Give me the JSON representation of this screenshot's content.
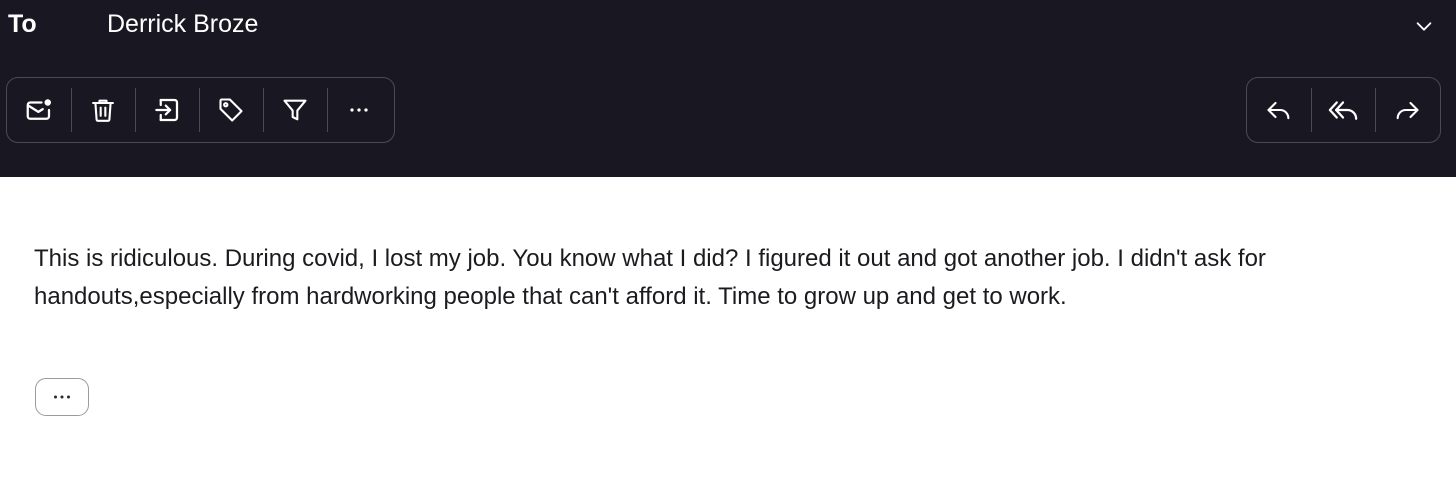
{
  "header": {
    "to_label": "To",
    "recipient": "Derrick Broze",
    "expand_icon": "chevron-down-icon"
  },
  "toolbar_left": [
    {
      "icon": "mark-unread-icon"
    },
    {
      "icon": "trash-icon"
    },
    {
      "icon": "move-to-folder-icon"
    },
    {
      "icon": "tag-icon"
    },
    {
      "icon": "filter-icon"
    },
    {
      "icon": "more-horizontal-icon"
    }
  ],
  "toolbar_right": [
    {
      "icon": "reply-icon"
    },
    {
      "icon": "reply-all-icon"
    },
    {
      "icon": "forward-icon"
    }
  ],
  "message": {
    "body": "This is ridiculous. During covid, I lost my job. You know what I did? I figured it out and got another job. I didn't ask for handouts,especially from hardworking people that can't afford it. Time to grow up and get to work.",
    "show_more_icon": "more-horizontal-icon"
  },
  "colors": {
    "header_bg": "#191822",
    "border": "#4a4958",
    "icon": "#ffffff",
    "body_text": "#1b1b1f"
  }
}
